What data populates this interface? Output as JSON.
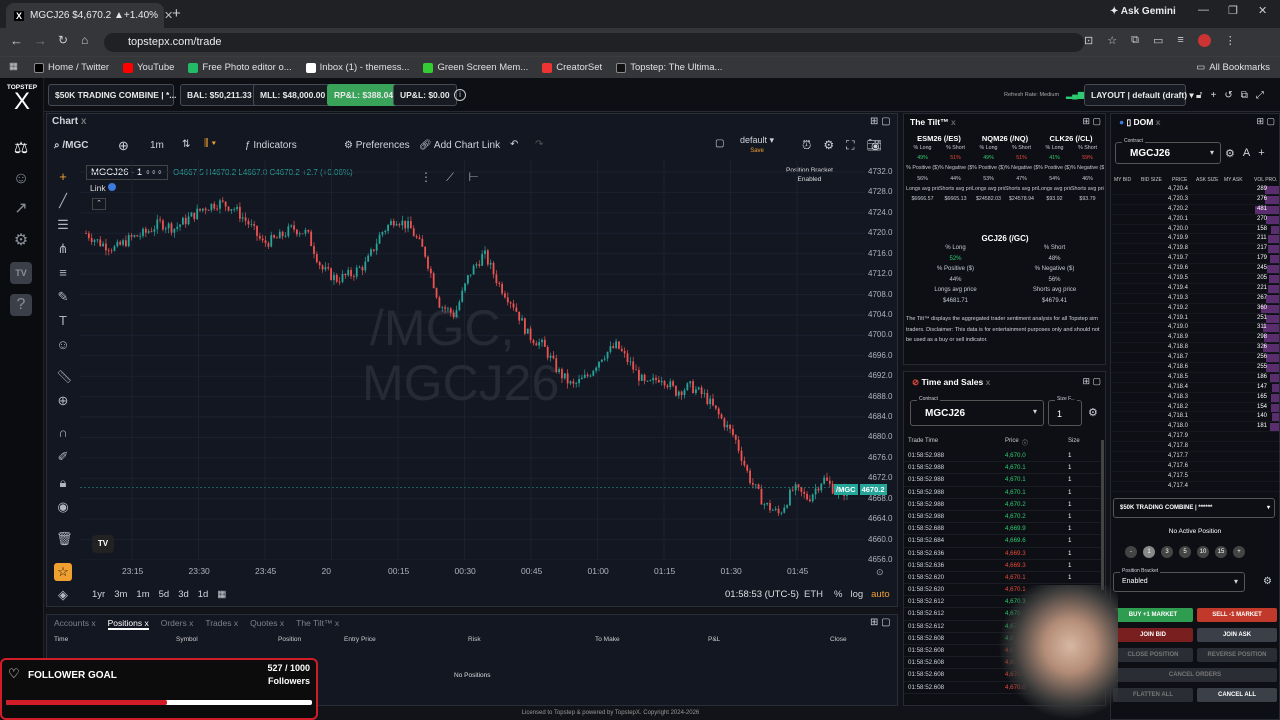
{
  "browser": {
    "tab_title": "MGCJ26 $4,670.2 ▲+1.40%",
    "url": "topstepx.com/trade",
    "ask_gemini": "Ask Gemini",
    "bookmarks": [
      "Home / Twitter",
      "YouTube",
      "Free Photo editor o...",
      "Inbox (1) - themess...",
      "Green Screen Mem...",
      "CreatorSet",
      "Topstep: The Ultima..."
    ],
    "all_bookmarks": "All Bookmarks"
  },
  "header": {
    "logo": "TOPSTEP",
    "account": "$50K TRADING COMBINE | *...",
    "bal": "BAL: $50,211.33",
    "mll": "MLL: $48,000.00",
    "rpl": "RP&L: $388.04",
    "upl": "UP&L: $0.00",
    "refresh": "Refresh Rate: Medium",
    "layout": "LAYOUT | default (draft)"
  },
  "chart": {
    "tab": "Chart",
    "symbol": "/MGC",
    "interval": "1m",
    "indicators": "Indicators",
    "preferences": "Preferences",
    "add_chart_link": "Add Chart Link",
    "layout_name": "default",
    "layout_status": "Save",
    "legend_symbol": "MGCJ26 · 1",
    "ohlc": "O4667.5 H4670.2 L4667.0 C4670.2 +2.7 (+0.06%)",
    "link": "Link",
    "position_bracket": "Position Bracket",
    "position_bracket_status": "Enabled",
    "watermark1": "/MGC,",
    "watermark2": "MGCJ26",
    "price_tag_symbol": "/MGC",
    "price_tag_value": "4670.2",
    "ranges": [
      "1yr",
      "3m",
      "1m",
      "5d",
      "3d",
      "1d"
    ],
    "clock": "01:58:53 (UTC-5)",
    "session": "ETH",
    "scale_opts": [
      "%",
      "log",
      "auto"
    ]
  },
  "chart_data": {
    "type": "candlestick",
    "y_ticks": [
      "4732.0",
      "4728.0",
      "4724.0",
      "4720.0",
      "4716.0",
      "4712.0",
      "4708.0",
      "4704.0",
      "4700.0",
      "4696.0",
      "4692.0",
      "4688.0",
      "4684.0",
      "4680.0",
      "4676.0",
      "4672.0",
      "4668.0",
      "4664.0",
      "4660.0",
      "4656.0"
    ],
    "x_ticks": [
      "23:15",
      "23:30",
      "23:45",
      "20",
      "00:15",
      "00:30",
      "00:45",
      "01:00",
      "01:15",
      "01:30",
      "01:45"
    ],
    "ylim": [
      4656,
      4732
    ],
    "close_path": [
      4720,
      4718,
      4717,
      4719,
      4720,
      4722,
      4721,
      4723,
      4725,
      4726,
      4725,
      4722,
      4718,
      4719,
      4721,
      4720,
      4713,
      4711,
      4712,
      4714,
      4720,
      4723,
      4721,
      4716,
      4706,
      4704,
      4712,
      4716,
      4710,
      4706,
      4700,
      4698,
      4693,
      4690,
      4692,
      4696,
      4698,
      4694,
      4690,
      4692,
      4689,
      4690,
      4688,
      4684,
      4680,
      4672,
      4667,
      4665,
      4670,
      4668,
      4672,
      4669,
      4670
    ],
    "last": 4670.2
  },
  "bottom": {
    "tabs": [
      "Accounts",
      "Positions",
      "Orders",
      "Trades",
      "Quotes",
      "The Tilt™"
    ],
    "columns": [
      "Time",
      "Symbol",
      "Position",
      "Entry Price",
      "Risk",
      "To Make",
      "P&L",
      "Close"
    ],
    "empty": "No Positions"
  },
  "follower": {
    "label": "FOLLOWER GOAL",
    "count": "527 / 1000",
    "unit": "Followers",
    "progress": 0.527
  },
  "tilt": {
    "title": "The Tilt™",
    "contracts": [
      {
        "name": "ESM26 (/ES)",
        "long": "49%",
        "short": "51%",
        "pos": "56%",
        "neg": "44%",
        "lavg": "$6666.57",
        "savg": "$6665.13"
      },
      {
        "name": "NQM26 (/NQ)",
        "long": "49%",
        "short": "51%",
        "pos": "53%",
        "neg": "47%",
        "lavg": "$24582.03",
        "savg": "$24578.94"
      },
      {
        "name": "CLK26 (/CL)",
        "long": "41%",
        "short": "59%",
        "pos": "54%",
        "neg": "46%",
        "lavg": "$93.92",
        "savg": "$93.79"
      }
    ],
    "gc": {
      "name": "GCJ26 (/GC)",
      "long": "52%",
      "short": "48%",
      "pos": "44%",
      "neg": "56%",
      "lavg": "$4681.71",
      "savg": "$4679.41"
    },
    "labels": {
      "long": "% Long",
      "short": "% Short",
      "pos": "% Positive ($)",
      "neg": "% Negative ($)",
      "lavg": "Longs avg price",
      "savg": "Shorts avg price"
    },
    "disclaimer": "The Tilt™ displays the aggregated trader sentiment analysis for all Topstep sim traders. Disclaimer: This data is for entertainment purposes only and should not be used as a buy or sell indicator."
  },
  "tns": {
    "title": "Time and Sales",
    "contract_label": "Contract",
    "contract": "MGCJ26",
    "size_label": "Size F...",
    "size": "1",
    "columns": [
      "Trade Time",
      "Price",
      "Size"
    ],
    "rows": [
      [
        "01:58:52.988",
        "4,670.0",
        "g"
      ],
      [
        "01:58:52.988",
        "4,670.1",
        "g"
      ],
      [
        "01:58:52.988",
        "4,670.1",
        "g"
      ],
      [
        "01:58:52.988",
        "4,670.1",
        "g"
      ],
      [
        "01:58:52.988",
        "4,670.2",
        "g"
      ],
      [
        "01:58:52.988",
        "4,670.2",
        "g"
      ],
      [
        "01:58:52.688",
        "4,669.9",
        "g"
      ],
      [
        "01:58:52.684",
        "4,669.6",
        "g"
      ],
      [
        "01:58:52.636",
        "4,669.3",
        "r"
      ],
      [
        "01:58:52.636",
        "4,669.3",
        "r"
      ],
      [
        "01:58:52.620",
        "4,670.1",
        "r"
      ],
      [
        "01:58:52.620",
        "4,670.1",
        "r"
      ],
      [
        "01:58:52.612",
        "4,670.3",
        "g"
      ],
      [
        "01:58:52.612",
        "4,670.4",
        "g"
      ],
      [
        "01:58:52.612",
        "4,670.4",
        "g"
      ],
      [
        "01:58:52.608",
        "4,670.4",
        "g"
      ],
      [
        "01:58:52.608",
        "4,670.0",
        "r"
      ],
      [
        "01:58:52.608",
        "4,670.0",
        "r"
      ],
      [
        "01:58:52.608",
        "4,670.0",
        "r"
      ],
      [
        "01:58:52.608",
        "4,670.0",
        "r"
      ]
    ]
  },
  "dom": {
    "title": "DOM",
    "contract_label": "Contract",
    "contract": "MGCJ26",
    "columns": [
      "MY BID",
      "BID SIZE",
      "PRICE",
      "ASK SIZE",
      "MY ASK",
      "VOL PRO."
    ],
    "prices": [
      "4,720.4",
      "4,720.3",
      "4,720.2",
      "4,720.1",
      "4,720.0",
      "4,719.9",
      "4,719.8",
      "4,719.7",
      "4,719.6",
      "4,719.5",
      "4,719.4",
      "4,719.3",
      "4,719.2",
      "4,719.1",
      "4,719.0",
      "4,718.9",
      "4,718.8",
      "4,718.7",
      "4,718.6",
      "4,718.5",
      "4,718.4",
      "4,718.3",
      "4,718.2",
      "4,718.1",
      "4,718.0",
      "4,717.9",
      "4,717.8",
      "4,717.7",
      "4,717.6",
      "4,717.5",
      "4,717.4"
    ],
    "vols": [
      "289",
      "276",
      "481",
      "270",
      "158",
      "211",
      "217",
      "179",
      "245",
      "205",
      "221",
      "267",
      "360",
      "251",
      "311",
      "298",
      "326",
      "256",
      "255",
      "186",
      "147",
      "165",
      "154",
      "140",
      "181",
      "",
      "",
      "",
      "",
      "",
      ""
    ],
    "account": "$50K TRADING COMBINE | ******",
    "no_position": "No Active Position",
    "qty": [
      "-",
      "1",
      "3",
      "5",
      "10",
      "15",
      "+"
    ],
    "bracket_label": "Position Bracket",
    "bracket": "Enabled",
    "buy": "BUY +1 MARKET",
    "sell": "SELL -1 MARKET",
    "join_bid": "JOIN BID",
    "join_ask": "JOIN ASK",
    "close_pos": "CLOSE POSITION",
    "reverse": "REVERSE POSITION",
    "cancel_orders": "CANCEL ORDERS",
    "flatten": "FLATTEN ALL",
    "cancel_all": "CANCEL ALL"
  },
  "footer": "Licensed to Topstep & powered by TopstepX. Copyright 2024-2026"
}
